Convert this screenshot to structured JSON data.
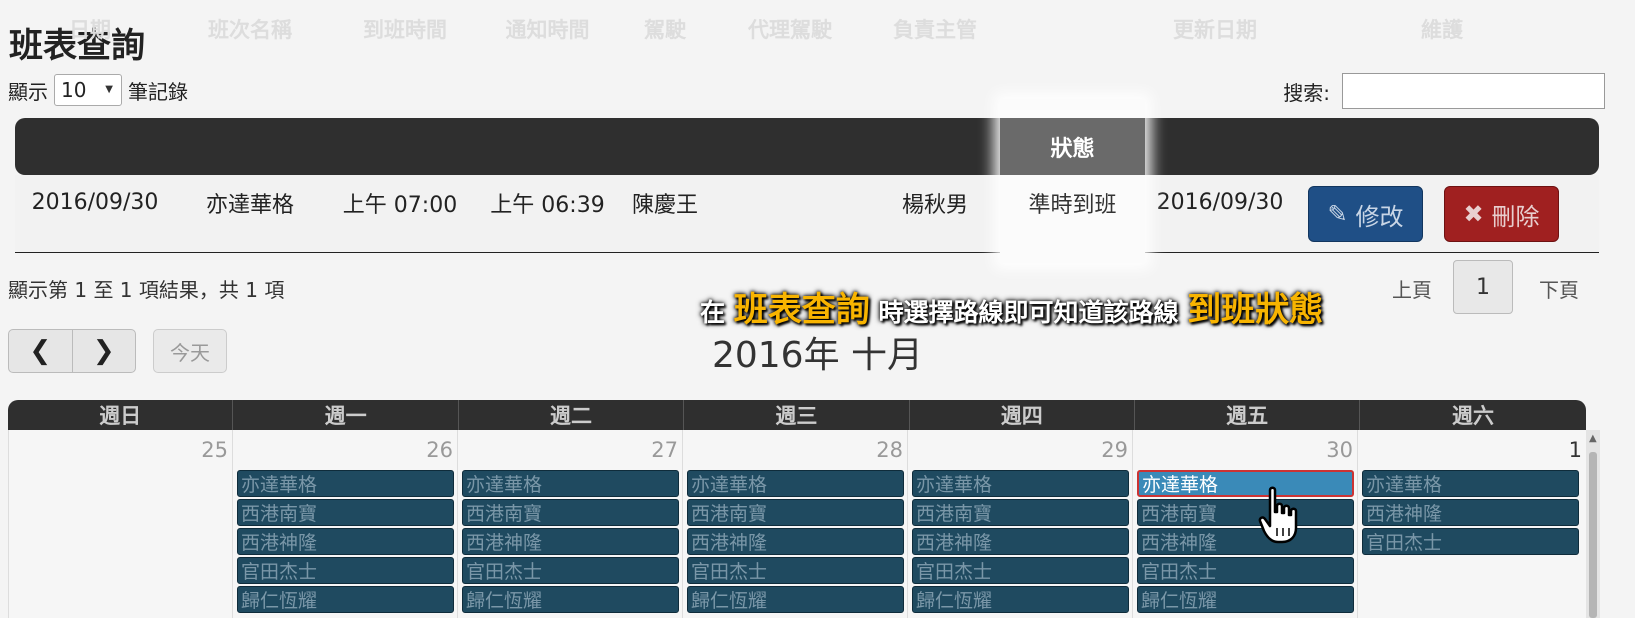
{
  "page": {
    "title": "班表查詢"
  },
  "length_menu": {
    "prefix": "顯示",
    "value": "10",
    "suffix": "筆記錄"
  },
  "search": {
    "label": "搜索:"
  },
  "table": {
    "headers": [
      "日期",
      "班次名稱",
      "到班時間",
      "通知時間",
      "駕駛",
      "代理駕駛",
      "負責主管",
      "狀態",
      "更新日期",
      "維護"
    ],
    "row": {
      "date": "2016/09/30",
      "shift": "亦達華格",
      "arrive": "上午 07:00",
      "notify": "上午 06:39",
      "driver": "陳慶王",
      "proxy": "",
      "manager": "楊秋男",
      "status": "準時到班",
      "updated": "2016/09/30"
    },
    "edit_label": "修改",
    "delete_label": "刪除"
  },
  "pagination": {
    "info": "顯示第 1 至 1 項結果，共 1 項",
    "prev": "上頁",
    "current": "1",
    "next": "下頁"
  },
  "banner": {
    "pre": "在",
    "hl1": "班表查詢",
    "mid": "時選擇路線即可知道該路線",
    "hl2": "到班狀態"
  },
  "calendar": {
    "title": "2016年 十月",
    "today_label": "今天",
    "prev_icon": "chevron-left-icon",
    "next_icon": "chevron-right-icon",
    "weekdays": [
      "週日",
      "週一",
      "週二",
      "週三",
      "週四",
      "週五",
      "週六"
    ],
    "days": [
      {
        "num": "25",
        "events": []
      },
      {
        "num": "26",
        "events": [
          "亦達華格",
          "西港南寶",
          "西港神隆",
          "官田杰士",
          "歸仁恆耀"
        ]
      },
      {
        "num": "27",
        "events": [
          "亦達華格",
          "西港南寶",
          "西港神隆",
          "官田杰士",
          "歸仁恆耀"
        ]
      },
      {
        "num": "28",
        "events": [
          "亦達華格",
          "西港南寶",
          "西港神隆",
          "官田杰士",
          "歸仁恆耀"
        ]
      },
      {
        "num": "29",
        "events": [
          "亦達華格",
          "西港南寶",
          "西港神隆",
          "官田杰士",
          "歸仁恆耀"
        ]
      },
      {
        "num": "30",
        "events": [
          "亦達華格",
          "西港南寶",
          "西港神隆",
          "官田杰士",
          "歸仁恆耀"
        ]
      },
      {
        "num": "1",
        "events": [
          "亦達華格",
          "西港神隆",
          "官田杰士"
        ]
      }
    ]
  },
  "colors": {
    "accent_orange": "#f8b400",
    "edit_blue": "#1f4f86",
    "delete_red": "#a02020",
    "event_blue": "#1f4a60"
  }
}
